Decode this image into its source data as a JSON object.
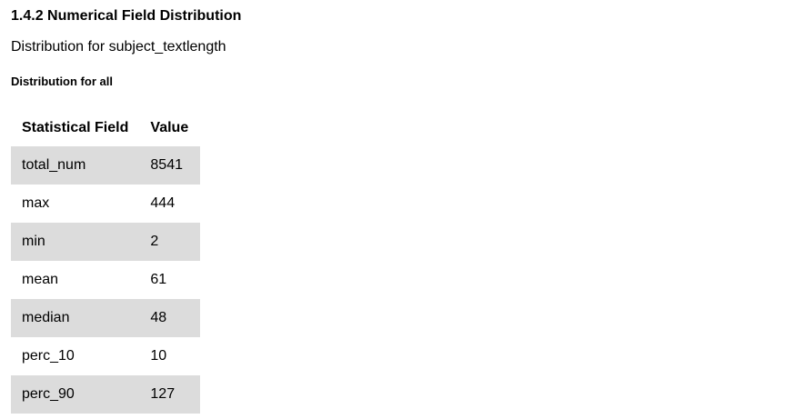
{
  "section": {
    "title": "1.4.2 Numerical Field Distribution",
    "subtitle": "Distribution for subject_textlength"
  },
  "group": {
    "title": "Distribution for all"
  },
  "table": {
    "headers": [
      "Statistical Field",
      "Value"
    ],
    "rows": [
      {
        "field": "total_num",
        "value": "8541"
      },
      {
        "field": "max",
        "value": "444"
      },
      {
        "field": "min",
        "value": "2"
      },
      {
        "field": "mean",
        "value": "61"
      },
      {
        "field": "median",
        "value": "48"
      },
      {
        "field": "perc_10",
        "value": "10"
      },
      {
        "field": "perc_90",
        "value": "127"
      }
    ]
  },
  "colors": {
    "stripe": "#dcdcdc",
    "text": "#000000",
    "background": "#ffffff"
  }
}
